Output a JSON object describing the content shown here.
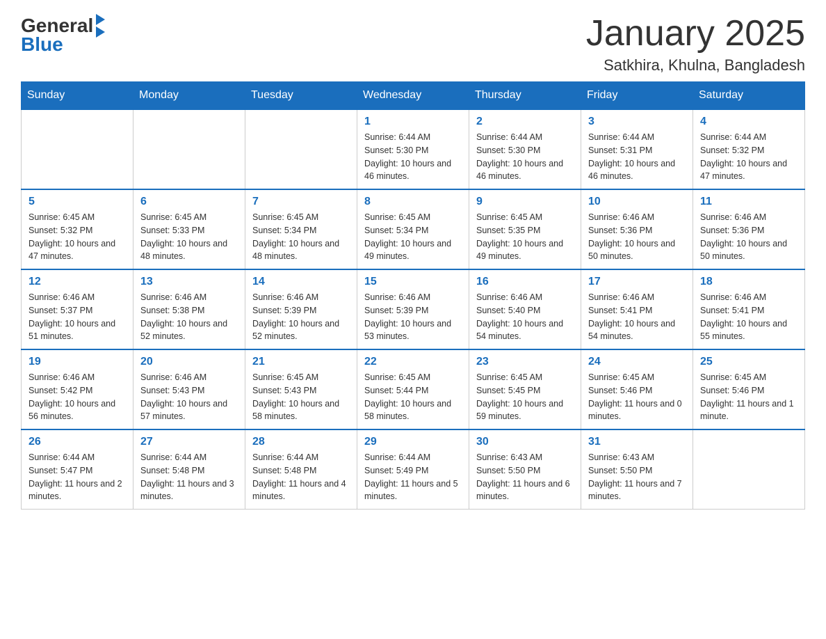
{
  "header": {
    "logo_text_general": "General",
    "logo_text_blue": "Blue",
    "title": "January 2025",
    "subtitle": "Satkhira, Khulna, Bangladesh"
  },
  "weekdays": [
    "Sunday",
    "Monday",
    "Tuesday",
    "Wednesday",
    "Thursday",
    "Friday",
    "Saturday"
  ],
  "weeks": [
    [
      {
        "day": "",
        "info": ""
      },
      {
        "day": "",
        "info": ""
      },
      {
        "day": "",
        "info": ""
      },
      {
        "day": "1",
        "info": "Sunrise: 6:44 AM\nSunset: 5:30 PM\nDaylight: 10 hours and 46 minutes."
      },
      {
        "day": "2",
        "info": "Sunrise: 6:44 AM\nSunset: 5:30 PM\nDaylight: 10 hours and 46 minutes."
      },
      {
        "day": "3",
        "info": "Sunrise: 6:44 AM\nSunset: 5:31 PM\nDaylight: 10 hours and 46 minutes."
      },
      {
        "day": "4",
        "info": "Sunrise: 6:44 AM\nSunset: 5:32 PM\nDaylight: 10 hours and 47 minutes."
      }
    ],
    [
      {
        "day": "5",
        "info": "Sunrise: 6:45 AM\nSunset: 5:32 PM\nDaylight: 10 hours and 47 minutes."
      },
      {
        "day": "6",
        "info": "Sunrise: 6:45 AM\nSunset: 5:33 PM\nDaylight: 10 hours and 48 minutes."
      },
      {
        "day": "7",
        "info": "Sunrise: 6:45 AM\nSunset: 5:34 PM\nDaylight: 10 hours and 48 minutes."
      },
      {
        "day": "8",
        "info": "Sunrise: 6:45 AM\nSunset: 5:34 PM\nDaylight: 10 hours and 49 minutes."
      },
      {
        "day": "9",
        "info": "Sunrise: 6:45 AM\nSunset: 5:35 PM\nDaylight: 10 hours and 49 minutes."
      },
      {
        "day": "10",
        "info": "Sunrise: 6:46 AM\nSunset: 5:36 PM\nDaylight: 10 hours and 50 minutes."
      },
      {
        "day": "11",
        "info": "Sunrise: 6:46 AM\nSunset: 5:36 PM\nDaylight: 10 hours and 50 minutes."
      }
    ],
    [
      {
        "day": "12",
        "info": "Sunrise: 6:46 AM\nSunset: 5:37 PM\nDaylight: 10 hours and 51 minutes."
      },
      {
        "day": "13",
        "info": "Sunrise: 6:46 AM\nSunset: 5:38 PM\nDaylight: 10 hours and 52 minutes."
      },
      {
        "day": "14",
        "info": "Sunrise: 6:46 AM\nSunset: 5:39 PM\nDaylight: 10 hours and 52 minutes."
      },
      {
        "day": "15",
        "info": "Sunrise: 6:46 AM\nSunset: 5:39 PM\nDaylight: 10 hours and 53 minutes."
      },
      {
        "day": "16",
        "info": "Sunrise: 6:46 AM\nSunset: 5:40 PM\nDaylight: 10 hours and 54 minutes."
      },
      {
        "day": "17",
        "info": "Sunrise: 6:46 AM\nSunset: 5:41 PM\nDaylight: 10 hours and 54 minutes."
      },
      {
        "day": "18",
        "info": "Sunrise: 6:46 AM\nSunset: 5:41 PM\nDaylight: 10 hours and 55 minutes."
      }
    ],
    [
      {
        "day": "19",
        "info": "Sunrise: 6:46 AM\nSunset: 5:42 PM\nDaylight: 10 hours and 56 minutes."
      },
      {
        "day": "20",
        "info": "Sunrise: 6:46 AM\nSunset: 5:43 PM\nDaylight: 10 hours and 57 minutes."
      },
      {
        "day": "21",
        "info": "Sunrise: 6:45 AM\nSunset: 5:43 PM\nDaylight: 10 hours and 58 minutes."
      },
      {
        "day": "22",
        "info": "Sunrise: 6:45 AM\nSunset: 5:44 PM\nDaylight: 10 hours and 58 minutes."
      },
      {
        "day": "23",
        "info": "Sunrise: 6:45 AM\nSunset: 5:45 PM\nDaylight: 10 hours and 59 minutes."
      },
      {
        "day": "24",
        "info": "Sunrise: 6:45 AM\nSunset: 5:46 PM\nDaylight: 11 hours and 0 minutes."
      },
      {
        "day": "25",
        "info": "Sunrise: 6:45 AM\nSunset: 5:46 PM\nDaylight: 11 hours and 1 minute."
      }
    ],
    [
      {
        "day": "26",
        "info": "Sunrise: 6:44 AM\nSunset: 5:47 PM\nDaylight: 11 hours and 2 minutes."
      },
      {
        "day": "27",
        "info": "Sunrise: 6:44 AM\nSunset: 5:48 PM\nDaylight: 11 hours and 3 minutes."
      },
      {
        "day": "28",
        "info": "Sunrise: 6:44 AM\nSunset: 5:48 PM\nDaylight: 11 hours and 4 minutes."
      },
      {
        "day": "29",
        "info": "Sunrise: 6:44 AM\nSunset: 5:49 PM\nDaylight: 11 hours and 5 minutes."
      },
      {
        "day": "30",
        "info": "Sunrise: 6:43 AM\nSunset: 5:50 PM\nDaylight: 11 hours and 6 minutes."
      },
      {
        "day": "31",
        "info": "Sunrise: 6:43 AM\nSunset: 5:50 PM\nDaylight: 11 hours and 7 minutes."
      },
      {
        "day": "",
        "info": ""
      }
    ]
  ]
}
